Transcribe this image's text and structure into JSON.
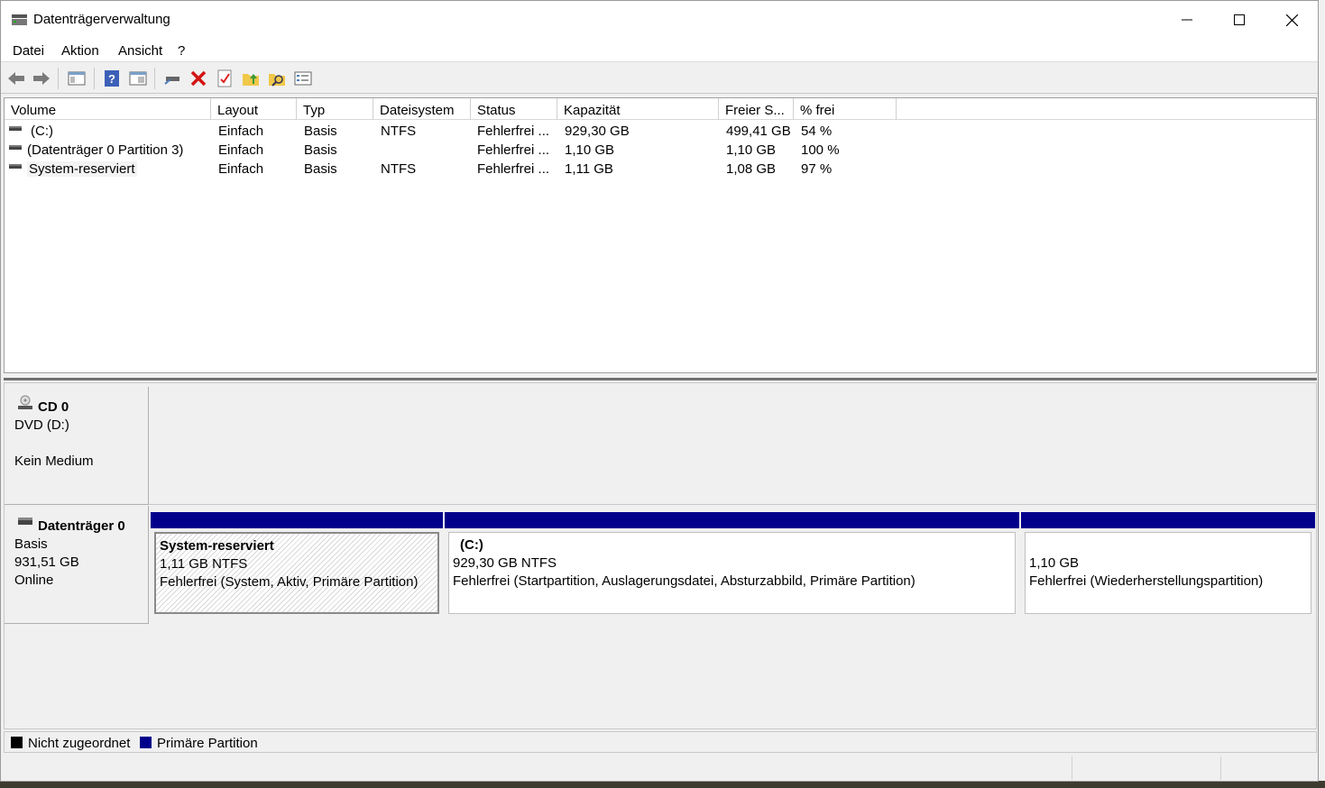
{
  "window": {
    "title": "Datenträgerverwaltung"
  },
  "menu": [
    "Datei",
    "Aktion",
    "Ansicht",
    "?"
  ],
  "toolbar": [
    "back-arrow-icon",
    "forward-arrow-icon",
    "console-tree-icon",
    "help-icon",
    "view-icon",
    "connect-icon",
    "delete-icon",
    "properties-icon",
    "folder-up-icon",
    "search-folder-icon",
    "list-view-icon"
  ],
  "volume_table": {
    "headers": [
      "Volume",
      "Layout",
      "Typ",
      "Dateisystem",
      "Status",
      "Kapazität",
      "Freier S...",
      "% frei"
    ],
    "rows": [
      [
        "(C:)",
        "Einfach",
        "Basis",
        "NTFS",
        "Fehlerfrei ...",
        "929,30 GB",
        "499,41 GB",
        "54 %"
      ],
      [
        "(Datenträger 0 Partition 3)",
        "Einfach",
        "Basis",
        "",
        "Fehlerfrei ...",
        "1,10 GB",
        "1,10 GB",
        "100 %"
      ],
      [
        "System-reserviert",
        "Einfach",
        "Basis",
        "NTFS",
        "Fehlerfrei ...",
        "1,11 GB",
        "1,08 GB",
        "97 %"
      ]
    ]
  },
  "disks": {
    "cd": {
      "name": "CD 0",
      "drive": "DVD (D:)",
      "status": "Kein Medium"
    },
    "disk0": {
      "name": "Datenträger 0",
      "type": "Basis",
      "size": "931,51 GB",
      "status": "Online",
      "partitions": [
        {
          "title": "System-reserviert",
          "size": "1,11 GB NTFS",
          "status": "Fehlerfrei (System, Aktiv, Primäre Partition)"
        },
        {
          "title": "(C:)",
          "size": "929,30 GB NTFS",
          "status": "Fehlerfrei (Startpartition, Auslagerungsdatei, Absturzabbild, Primäre Partition)"
        },
        {
          "title": "",
          "size": "1,10 GB",
          "status": "Fehlerfrei (Wiederherstellungspartition)"
        }
      ]
    }
  },
  "legend": {
    "unallocated": "Nicht zugeordnet",
    "primary": "Primäre Partition",
    "colors": {
      "unallocated": "#000000",
      "primary": "#00008b"
    }
  }
}
